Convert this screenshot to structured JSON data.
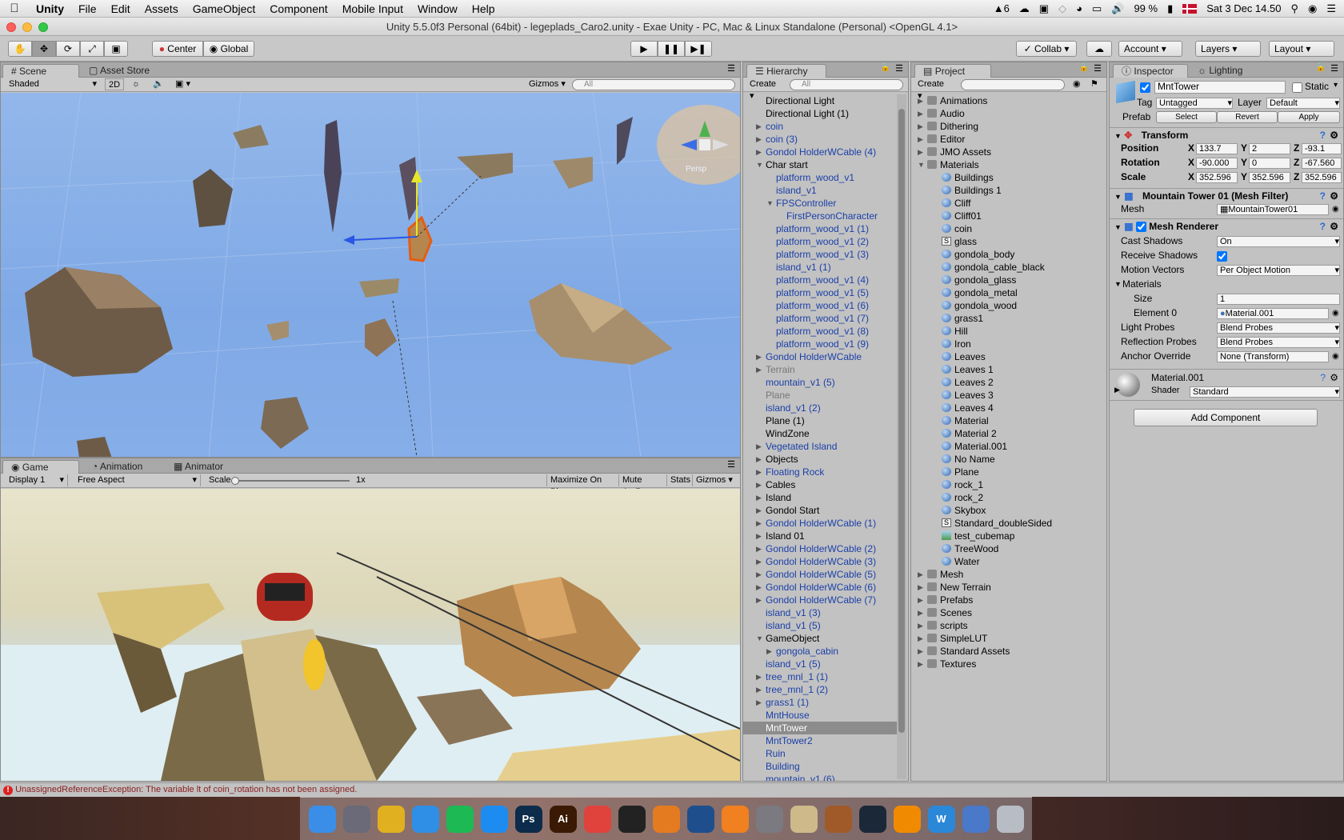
{
  "menubar": {
    "app": "Unity",
    "items": [
      "File",
      "Edit",
      "Assets",
      "GameObject",
      "Component",
      "Mobile Input",
      "Window",
      "Help"
    ],
    "status_count": "6",
    "battery": "99 %",
    "clock": "Sat 3 Dec  14.50"
  },
  "window": {
    "title": "Unity 5.5.0f3 Personal (64bit) - legeplads_Caro2.unity - Exae Unity - PC, Mac & Linux Standalone (Personal) <OpenGL 4.1>"
  },
  "toolbar": {
    "pivot": "Center",
    "space": "Global",
    "collab": "Collab",
    "account": "Account",
    "layers": "Layers",
    "layout": "Layout"
  },
  "scene": {
    "tabs": [
      "Scene",
      "Asset Store"
    ],
    "shading": "Shaded",
    "mode_2d": "2D",
    "gizmos": "Gizmos",
    "search_placeholder": "All",
    "persp": "Persp"
  },
  "game": {
    "tabs": [
      "Game",
      "Animation",
      "Animator"
    ],
    "display": "Display 1",
    "aspect": "Free Aspect",
    "scale_label": "Scale",
    "scale_value": "1x",
    "buttons": [
      "Maximize On Play",
      "Mute Audio",
      "Stats",
      "Gizmos"
    ]
  },
  "hierarchy": {
    "tab": "Hierarchy",
    "create": "Create",
    "search_placeholder": "All",
    "rows": [
      {
        "t": "Directional Light",
        "i": 0,
        "c": "k",
        "a": ""
      },
      {
        "t": "Directional Light (1)",
        "i": 0,
        "c": "k",
        "a": ""
      },
      {
        "t": "coin",
        "i": 0,
        "c": "b",
        "a": "r"
      },
      {
        "t": "coin (3)",
        "i": 0,
        "c": "b",
        "a": "r"
      },
      {
        "t": "Gondol HolderWCable (4)",
        "i": 0,
        "c": "b",
        "a": "r"
      },
      {
        "t": "Char start",
        "i": 0,
        "c": "k",
        "a": "d"
      },
      {
        "t": "platform_wood_v1",
        "i": 1,
        "c": "b",
        "a": ""
      },
      {
        "t": "island_v1",
        "i": 1,
        "c": "b",
        "a": ""
      },
      {
        "t": "FPSController",
        "i": 1,
        "c": "b",
        "a": "d"
      },
      {
        "t": "FirstPersonCharacter",
        "i": 2,
        "c": "b",
        "a": ""
      },
      {
        "t": "platform_wood_v1 (1)",
        "i": 1,
        "c": "b",
        "a": ""
      },
      {
        "t": "platform_wood_v1 (2)",
        "i": 1,
        "c": "b",
        "a": ""
      },
      {
        "t": "platform_wood_v1 (3)",
        "i": 1,
        "c": "b",
        "a": ""
      },
      {
        "t": "island_v1 (1)",
        "i": 1,
        "c": "b",
        "a": ""
      },
      {
        "t": "platform_wood_v1 (4)",
        "i": 1,
        "c": "b",
        "a": ""
      },
      {
        "t": "platform_wood_v1 (5)",
        "i": 1,
        "c": "b",
        "a": ""
      },
      {
        "t": "platform_wood_v1 (6)",
        "i": 1,
        "c": "b",
        "a": ""
      },
      {
        "t": "platform_wood_v1 (7)",
        "i": 1,
        "c": "b",
        "a": ""
      },
      {
        "t": "platform_wood_v1 (8)",
        "i": 1,
        "c": "b",
        "a": ""
      },
      {
        "t": "platform_wood_v1 (9)",
        "i": 1,
        "c": "b",
        "a": ""
      },
      {
        "t": "Gondol HolderWCable",
        "i": 0,
        "c": "b",
        "a": "r"
      },
      {
        "t": "Terrain",
        "i": 0,
        "c": "g",
        "a": "r"
      },
      {
        "t": "mountain_v1 (5)",
        "i": 0,
        "c": "b",
        "a": ""
      },
      {
        "t": "Plane",
        "i": 0,
        "c": "g",
        "a": ""
      },
      {
        "t": "island_v1 (2)",
        "i": 0,
        "c": "b",
        "a": ""
      },
      {
        "t": "Plane (1)",
        "i": 0,
        "c": "k",
        "a": ""
      },
      {
        "t": "WindZone",
        "i": 0,
        "c": "k",
        "a": ""
      },
      {
        "t": "Vegetated Island",
        "i": 0,
        "c": "b",
        "a": "r"
      },
      {
        "t": "Objects",
        "i": 0,
        "c": "k",
        "a": "r"
      },
      {
        "t": "Floating Rock",
        "i": 0,
        "c": "b",
        "a": "r"
      },
      {
        "t": "Cables",
        "i": 0,
        "c": "k",
        "a": "r"
      },
      {
        "t": "Island",
        "i": 0,
        "c": "k",
        "a": "r"
      },
      {
        "t": "Gondol Start",
        "i": 0,
        "c": "k",
        "a": "r"
      },
      {
        "t": "Gondol HolderWCable (1)",
        "i": 0,
        "c": "b",
        "a": "r"
      },
      {
        "t": "Island 01",
        "i": 0,
        "c": "k",
        "a": "r"
      },
      {
        "t": "Gondol HolderWCable (2)",
        "i": 0,
        "c": "b",
        "a": "r"
      },
      {
        "t": "Gondol HolderWCable (3)",
        "i": 0,
        "c": "b",
        "a": "r"
      },
      {
        "t": "Gondol HolderWCable (5)",
        "i": 0,
        "c": "b",
        "a": "r"
      },
      {
        "t": "Gondol HolderWCable (6)",
        "i": 0,
        "c": "b",
        "a": "r"
      },
      {
        "t": "Gondol HolderWCable (7)",
        "i": 0,
        "c": "b",
        "a": "r"
      },
      {
        "t": "island_v1 (3)",
        "i": 0,
        "c": "b",
        "a": ""
      },
      {
        "t": "island_v1 (5)",
        "i": 0,
        "c": "b",
        "a": ""
      },
      {
        "t": "GameObject",
        "i": 0,
        "c": "k",
        "a": "d"
      },
      {
        "t": "gongola_cabin",
        "i": 1,
        "c": "b",
        "a": "r"
      },
      {
        "t": "island_v1 (5)",
        "i": 0,
        "c": "b",
        "a": ""
      },
      {
        "t": "tree_mnl_1 (1)",
        "i": 0,
        "c": "b",
        "a": "r"
      },
      {
        "t": "tree_mnl_1 (2)",
        "i": 0,
        "c": "b",
        "a": "r"
      },
      {
        "t": "grass1 (1)",
        "i": 0,
        "c": "b",
        "a": "r"
      },
      {
        "t": "MntHouse",
        "i": 0,
        "c": "b",
        "a": ""
      },
      {
        "t": "MntTower",
        "i": 0,
        "c": "s",
        "a": ""
      },
      {
        "t": "MntTower2",
        "i": 0,
        "c": "b",
        "a": ""
      },
      {
        "t": "Ruin",
        "i": 0,
        "c": "b",
        "a": ""
      },
      {
        "t": "Building",
        "i": 0,
        "c": "b",
        "a": ""
      },
      {
        "t": "mountain_v1 (6)",
        "i": 0,
        "c": "b",
        "a": ""
      }
    ]
  },
  "project": {
    "tab": "Project",
    "create": "Create",
    "rows": [
      {
        "t": "Animations",
        "i": 0,
        "k": "folder",
        "a": "r"
      },
      {
        "t": "Audio",
        "i": 0,
        "k": "folder",
        "a": "r"
      },
      {
        "t": "Dithering",
        "i": 0,
        "k": "folder",
        "a": "r"
      },
      {
        "t": "Editor",
        "i": 0,
        "k": "folder",
        "a": "r"
      },
      {
        "t": "JMO Assets",
        "i": 0,
        "k": "folder",
        "a": "r"
      },
      {
        "t": "Materials",
        "i": 0,
        "k": "folder",
        "a": "d"
      },
      {
        "t": "Buildings",
        "i": 1,
        "k": "mat",
        "a": ""
      },
      {
        "t": "Buildings 1",
        "i": 1,
        "k": "mat",
        "a": ""
      },
      {
        "t": "Cliff",
        "i": 1,
        "k": "mat",
        "a": ""
      },
      {
        "t": "Cliff01",
        "i": 1,
        "k": "mat",
        "a": ""
      },
      {
        "t": "coin",
        "i": 1,
        "k": "mat",
        "a": ""
      },
      {
        "t": "glass",
        "i": 1,
        "k": "shader",
        "a": ""
      },
      {
        "t": "gondola_body",
        "i": 1,
        "k": "mat",
        "a": ""
      },
      {
        "t": "gondola_cable_black",
        "i": 1,
        "k": "mat",
        "a": ""
      },
      {
        "t": "gondola_glass",
        "i": 1,
        "k": "mat",
        "a": ""
      },
      {
        "t": "gondola_metal",
        "i": 1,
        "k": "mat",
        "a": ""
      },
      {
        "t": "gondola_wood",
        "i": 1,
        "k": "mat",
        "a": ""
      },
      {
        "t": "grass1",
        "i": 1,
        "k": "mat",
        "a": ""
      },
      {
        "t": "Hill",
        "i": 1,
        "k": "mat",
        "a": ""
      },
      {
        "t": "Iron",
        "i": 1,
        "k": "mat",
        "a": ""
      },
      {
        "t": "Leaves",
        "i": 1,
        "k": "mat",
        "a": ""
      },
      {
        "t": "Leaves 1",
        "i": 1,
        "k": "mat",
        "a": ""
      },
      {
        "t": "Leaves 2",
        "i": 1,
        "k": "mat",
        "a": ""
      },
      {
        "t": "Leaves 3",
        "i": 1,
        "k": "mat",
        "a": ""
      },
      {
        "t": "Leaves 4",
        "i": 1,
        "k": "mat",
        "a": ""
      },
      {
        "t": "Material",
        "i": 1,
        "k": "mat",
        "a": ""
      },
      {
        "t": "Material 2",
        "i": 1,
        "k": "mat",
        "a": ""
      },
      {
        "t": "Material.001",
        "i": 1,
        "k": "mat",
        "a": ""
      },
      {
        "t": "No Name",
        "i": 1,
        "k": "mat",
        "a": ""
      },
      {
        "t": "Plane",
        "i": 1,
        "k": "mat",
        "a": ""
      },
      {
        "t": "rock_1",
        "i": 1,
        "k": "mat",
        "a": ""
      },
      {
        "t": "rock_2",
        "i": 1,
        "k": "mat",
        "a": ""
      },
      {
        "t": "Skybox",
        "i": 1,
        "k": "mat",
        "a": ""
      },
      {
        "t": "Standard_doubleSided",
        "i": 1,
        "k": "shader",
        "a": ""
      },
      {
        "t": "test_cubemap",
        "i": 1,
        "k": "cubemap",
        "a": ""
      },
      {
        "t": "TreeWood",
        "i": 1,
        "k": "mat",
        "a": ""
      },
      {
        "t": "Water",
        "i": 1,
        "k": "mat",
        "a": ""
      },
      {
        "t": "Mesh",
        "i": 0,
        "k": "folder",
        "a": "r"
      },
      {
        "t": "New Terrain",
        "i": 0,
        "k": "folder",
        "a": "r"
      },
      {
        "t": "Prefabs",
        "i": 0,
        "k": "folder",
        "a": "r"
      },
      {
        "t": "Scenes",
        "i": 0,
        "k": "folder",
        "a": "r"
      },
      {
        "t": "scripts",
        "i": 0,
        "k": "folder",
        "a": "r"
      },
      {
        "t": "SimpleLUT",
        "i": 0,
        "k": "folder",
        "a": "r"
      },
      {
        "t": "Standard Assets",
        "i": 0,
        "k": "folder",
        "a": "r"
      },
      {
        "t": "Textures",
        "i": 0,
        "k": "folder",
        "a": "r"
      }
    ]
  },
  "inspector": {
    "tabs": [
      "Inspector",
      "Lighting"
    ],
    "name": "MntTower",
    "static": "Static",
    "tag_label": "Tag",
    "tag": "Untagged",
    "layer_label": "Layer",
    "layer": "Default",
    "prefab_label": "Prefab",
    "prefab_buttons": [
      "Select",
      "Revert",
      "Apply"
    ],
    "transform": {
      "title": "Transform",
      "labels": [
        "Position",
        "Rotation",
        "Scale"
      ],
      "axes": [
        "X",
        "Y",
        "Z"
      ],
      "position": [
        "133.7",
        "2",
        "-93.1"
      ],
      "rotation": [
        "-90.000",
        "0",
        "-67.560"
      ],
      "scale": [
        "352.596",
        "352.596",
        "352.596"
      ]
    },
    "mesh_filter": {
      "title": "Mountain Tower 01 (Mesh Filter)",
      "label": "Mesh",
      "value": "MountainTower01"
    },
    "renderer": {
      "title": "Mesh Renderer",
      "fields": [
        {
          "label": "Cast Shadows",
          "value": "On"
        },
        {
          "label": "Receive Shadows",
          "value": ""
        },
        {
          "label": "Motion Vectors",
          "value": "Per Object Motion"
        },
        {
          "label": "Materials",
          "value": ""
        },
        {
          "label": "Size",
          "value": "1"
        },
        {
          "label": "Element 0",
          "value": "Material.001"
        },
        {
          "label": "Light Probes",
          "value": "Blend Probes"
        },
        {
          "label": "Reflection Probes",
          "value": "Blend Probes"
        },
        {
          "label": "Anchor Override",
          "value": "None (Transform)"
        }
      ]
    },
    "material": {
      "name": "Material.001",
      "shader_label": "Shader",
      "shader": "Standard"
    },
    "add_component": "Add Component"
  },
  "console": {
    "error": "UnassignedReferenceException: The variable lt of coin_rotation has not been assigned."
  },
  "dock": [
    {
      "name": "finder",
      "label": "",
      "color": "#3b8ee8"
    },
    {
      "name": "launchpad",
      "label": "",
      "color": "#6a6a78"
    },
    {
      "name": "chrome",
      "label": "",
      "color": "#e0b020"
    },
    {
      "name": "safari",
      "label": "",
      "color": "#2f8fe6"
    },
    {
      "name": "spotify",
      "label": "",
      "color": "#1db954"
    },
    {
      "name": "app-store",
      "label": "",
      "color": "#1d8cf0"
    },
    {
      "name": "photoshop",
      "label": "Ps",
      "color": "#0d2b4a"
    },
    {
      "name": "illustrator",
      "label": "Ai",
      "color": "#3a1a04"
    },
    {
      "name": "speakerdeck",
      "label": "",
      "color": "#e0433c"
    },
    {
      "name": "unity",
      "label": "",
      "color": "#222222"
    },
    {
      "name": "blender",
      "label": "",
      "color": "#e47b21"
    },
    {
      "name": "sourcetree",
      "label": "",
      "color": "#1e4f8c"
    },
    {
      "name": "infuse",
      "label": "",
      "color": "#f08020"
    },
    {
      "name": "system-preferences",
      "label": "",
      "color": "#7a7a80"
    },
    {
      "name": "notes",
      "label": "",
      "color": "#cdb98a"
    },
    {
      "name": "books",
      "label": "",
      "color": "#a05a2a"
    },
    {
      "name": "steam",
      "label": "",
      "color": "#1b2838"
    },
    {
      "name": "vlc",
      "label": "",
      "color": "#f08a00"
    },
    {
      "name": "wunderlist",
      "label": "W",
      "color": "#2b88d9"
    },
    {
      "name": "preview",
      "label": "",
      "color": "#4a79c9"
    },
    {
      "name": "trash",
      "label": "",
      "color": "#b8bcc4"
    }
  ]
}
